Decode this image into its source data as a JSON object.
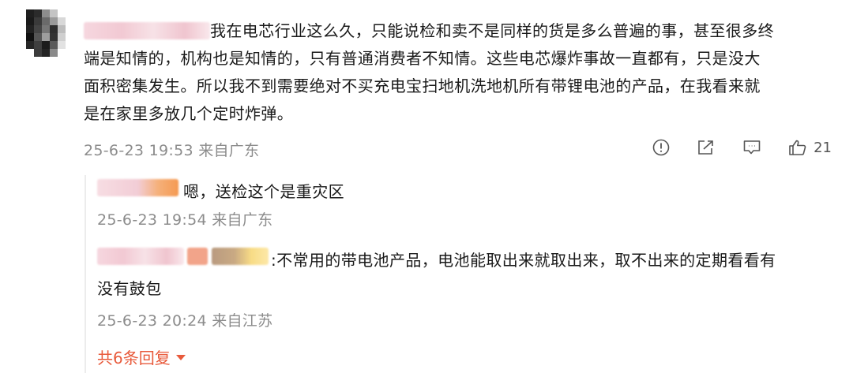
{
  "comment": {
    "text_line1": "我在电芯行业这么久，只能说检和卖不是同样的货是多么普遍的事，甚至很多终",
    "text_line2": "端是知情的，机构也是知情的，只有普通消费者不知情。这些电芯爆炸事故一直都有，只是没大",
    "text_line3": "面积密集发生。所以我不到需要绝对不买充电宝扫地机洗地机所有带锂电池的产品，在我看来就",
    "text_line4": "是在家里多放几个定时炸弹。",
    "meta": "25-6-23 19:53 来自广东",
    "like_count": "21",
    "icons": [
      "report-icon",
      "share-icon",
      "reply-icon",
      "like-icon"
    ]
  },
  "replies": [
    {
      "text": "嗯，送检这个是重灾区",
      "meta": "25-6-23 19:54 来自广东"
    },
    {
      "text_line1": ":不常用的带电池产品，电池能取出来就取出来，取不出来的定期看看有",
      "text_line2": "没有鼓包",
      "meta": "25-6-23 20:24 来自江苏"
    }
  ],
  "more_replies_label": "共6条回复",
  "colors": {
    "accent": "#e85a3b",
    "meta_text": "#8c8c8c",
    "thread_line": "#ececec"
  }
}
